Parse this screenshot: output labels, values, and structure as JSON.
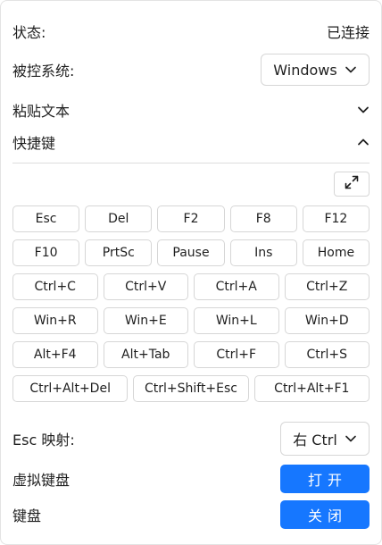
{
  "status": {
    "label": "状态:",
    "value": "已连接"
  },
  "os": {
    "label": "被控系统:",
    "selected": "Windows"
  },
  "paste_text": {
    "label": "粘贴文本"
  },
  "shortcuts": {
    "label": "快捷键",
    "rows": [
      [
        "Esc",
        "Del",
        "F2",
        "F8",
        "F12"
      ],
      [
        "F10",
        "PrtSc",
        "Pause",
        "Ins",
        "Home"
      ],
      [
        "Ctrl+C",
        "Ctrl+V",
        "Ctrl+A",
        "Ctrl+Z"
      ],
      [
        "Win+R",
        "Win+E",
        "Win+L",
        "Win+D"
      ],
      [
        "Alt+F4",
        "Alt+Tab",
        "Ctrl+F",
        "Ctrl+S"
      ],
      [
        "Ctrl+Alt+Del",
        "Ctrl+Shift+Esc",
        "Ctrl+Alt+F1"
      ]
    ]
  },
  "esc_map": {
    "label": "Esc 映射:",
    "selected": "右 Ctrl"
  },
  "virtual_keyboard": {
    "label": "虚拟键盘",
    "button": "打开"
  },
  "keyboard": {
    "label": "键盘",
    "button": "关闭"
  },
  "colors": {
    "accent": "#1677ff",
    "border": "#d6d6d6"
  },
  "icons": {
    "dropdown": "chevron-down-icon",
    "collapse": "chevron-up-icon",
    "expand": "expand-icon"
  }
}
